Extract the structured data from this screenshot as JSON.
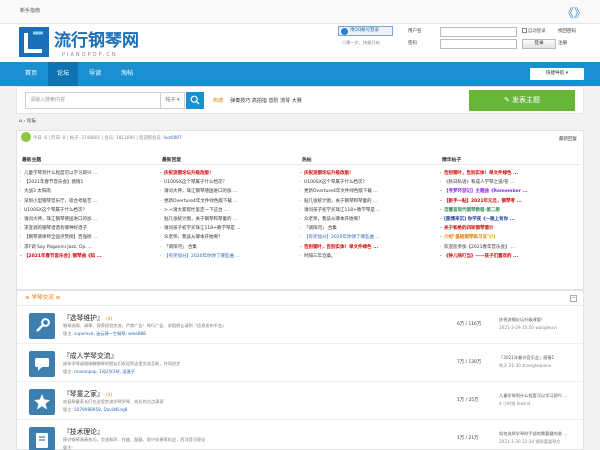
{
  "topbar": {
    "guide": "新手指南",
    "arrows": "《》"
  },
  "header": {
    "logo_text": "流行钢琴网",
    "logo_sub": "PIANOPOP.CN",
    "qq_login": "用QQ帐号登录",
    "quick_note": "只需一步，快速开始",
    "username_label": "用户名",
    "password_label": "密码",
    "remember": "自动登录",
    "forgot": "找回密码",
    "login_btn": "登录",
    "register": "注册"
  },
  "nav": {
    "items": [
      "首页",
      "论坛",
      "导读",
      "淘帖"
    ],
    "active_index": 1,
    "quick": "快捷导航"
  },
  "search": {
    "placeholder": "请输入搜索内容",
    "type": "帖子",
    "hot_label": "热搜:",
    "hot": [
      "弹奏技巧",
      "高拍指",
      "音阶",
      "流琴",
      "大赛"
    ],
    "post_btn": "发表主题"
  },
  "breadcrumb": {
    "home": "⌂",
    "sep": "›",
    "current": "论坛"
  },
  "stats": {
    "today_label": "今日: 6",
    "yesterday_label": "昨日: 8",
    "posts_label": "帖子: 3748801",
    "members_label": "会员: 1811690",
    "newest_label": "欢迎新会员:",
    "newest_user": "liuz0007",
    "latest_link": "最新回复"
  },
  "columns": [
    {
      "title": "最新主题",
      "items": [
        {
          "text": "儿童学琴到什么程度可以学习即兴 ...",
          "style": ""
        },
        {
          "text": "【2021年春节音乐会】感情1",
          "style": ""
        },
        {
          "text": "大战3 太阳雨",
          "style": ""
        },
        {
          "text": "深圳小型钢琴音乐厅，适合考级艺 ...",
          "style": ""
        },
        {
          "text": "U100SX这个琴属于什么档次？",
          "style": ""
        },
        {
          "text": "请问大神，珠江钢琴德国进口的加 ...",
          "style": ""
        },
        {
          "text": "求变调的钢琴谱谱有哪种好谱子",
          "style": ""
        },
        {
          "text": "【钢琴调律师全国点赞榜】百强榜 ...",
          "style": ""
        },
        {
          "text": "求F调 Say Paganini Jazz, Op. ...",
          "style": ""
        },
        {
          "text": "【2021年春节音乐会】钢琴曲《知 ...",
          "style": "red bold"
        }
      ]
    },
    {
      "title": "最新回复",
      "items": [
        {
          "text": "庆祝流钢论坛升级改版！",
          "style": "red bold"
        },
        {
          "text": "U100SX这个琴属于什么档次？",
          "style": ""
        },
        {
          "text": "请问大神，珠江钢琴德国进口的加 ...",
          "style": ""
        },
        {
          "text": "更新Overture4年文件绿色版下载 ...",
          "style": ""
        },
        {
          "text": ">.<请大家帮忙鉴定一下这台 ...",
          "style": ""
        },
        {
          "text": "贴几张统计图，关于钢琴和琴童的 ...",
          "style": ""
        },
        {
          "text": "请问孩子初学买珠江118+教学琴是 ...",
          "style": ""
        },
        {
          "text": "众老师，我该从哪本开始啊？",
          "style": ""
        },
        {
          "text": "「调阳河」 合集",
          "style": ""
        },
        {
          "text": "【有奖加分】2020年你弹了哪些曲 ...",
          "style": "blue"
        }
      ]
    },
    {
      "title": "热帖",
      "items": [
        {
          "text": "庆祝流钢论坛升级改版！",
          "style": "red bold"
        },
        {
          "text": "U100SX这个琴属于什么档次？",
          "style": ""
        },
        {
          "text": "更新Overture4年文件绿色版下载 ...",
          "style": ""
        },
        {
          "text": "贴几张统计图，关于钢琴和琴童的 ...",
          "style": ""
        },
        {
          "text": "请问孩子初学买珠江118+教学琴是 ...",
          "style": ""
        },
        {
          "text": "众老师，我该从哪本开始啊？",
          "style": ""
        },
        {
          "text": "「调阳河」 合集",
          "style": ""
        },
        {
          "text": "【有奖加分】2020年你弹了哪些曲 ...",
          "style": "blue"
        },
        {
          "text": "告别钢叶，告别实体！单文件绿色 ...",
          "style": "red bold"
        },
        {
          "text": "时隔三年沧桑。",
          "style": ""
        }
      ]
    },
    {
      "title": "精华帖子",
      "items": [
        {
          "text": "告别钢叶，告别实体！单文件绿色 ...",
          "style": "red bold"
        },
        {
          "text": "《秋日私语》和成人学琴之道/卷 ...",
          "style": ""
        },
        {
          "text": "【寻梦环游记】主题曲《Remember ...",
          "style": "purple bold"
        },
        {
          "text": "【新手一贴】2021年元旦，钢琴考 ...",
          "style": "red bold"
        },
        {
          "text": "活塞音现代钢琴教程-第二册",
          "style": "green bold"
        },
        {
          "text": "[图博来沉] 你学夜《一路上有你 ...",
          "style": "darkblue bold"
        },
        {
          "text": "关于和绝的四轮钢琴谱计",
          "style": "red bold"
        },
        {
          "text": "介绍\"基础钢琴练习法\"(!)",
          "style": "orange bold"
        },
        {
          "text": "欢迎您参加【2021春年音乐会】 ...",
          "style": ""
        },
        {
          "text": "《钟儿响叮当》——孩子们喜欢的 ...",
          "style": "red bold"
        }
      ]
    }
  ],
  "forum": {
    "section_title": "≡ 学琴交流 ≡",
    "collapse": "−",
    "rows": [
      {
        "icon": "wrench-icon",
        "name": "『选琴维护』",
        "count": "(4)",
        "desc": "钢琴选购、调律、保养经验交流，严禁广告！琴行广告、求租转让请到『信息发布平台』",
        "mods_label": "版主:",
        "mods": "supereva, 迷云建一生钢琴, wlee888",
        "num": "6万 / 116万",
        "last1": "庆祝流钢论坛升级改版！",
        "last2": "2021-3-29 15:50 wangleuvi"
      },
      {
        "icon": "chat-icon",
        "name": "『成人学琴交流』",
        "count": "",
        "desc": "成年学琴或刚接触钢琴的朋友们欢迎到这里交流互助，共同进步",
        "mods_label": "版主:",
        "mods": "monanpop, 1母2学3琴, 逗雅子",
        "num": "7万 / 130万",
        "last1": "「2021年春节音乐会」感情1",
        "last2": "昨天 21:30 zhangkepiano"
      },
      {
        "icon": "star-icon",
        "name": "『琴童之家』",
        "count": "(1)",
        "desc": "欢迎琴童家长们在这里交流学琴学琴、成长的点点滴滴",
        "mods_label": "版主:",
        "mods": "5079988958, DavidKing8",
        "num": "1万 / 25万",
        "last1": "儿童学琴到什么程度可以学习即兴 ...",
        "last2": "4 小时前 lkwind"
      },
      {
        "icon": "book-icon",
        "name": "『技术理论』",
        "count": "",
        "desc": "探讨钢琴演奏技巧，交流和声、作曲、配器、即兴伴奏等机会，西洋音乐理论",
        "mods_label": "版主:",
        "mods": "",
        "num": "1万 / 21万",
        "last1": "如何选择学琴时手部的需要健的谱 ...",
        "last2": "2021-1-30 22:34 钢琴喜爱琴文"
      }
    ]
  },
  "colors": {
    "brand_blue": "#1a8fd2",
    "nav_active": "#0d73b3",
    "green": "#66b735",
    "orange": "#e67e00"
  }
}
